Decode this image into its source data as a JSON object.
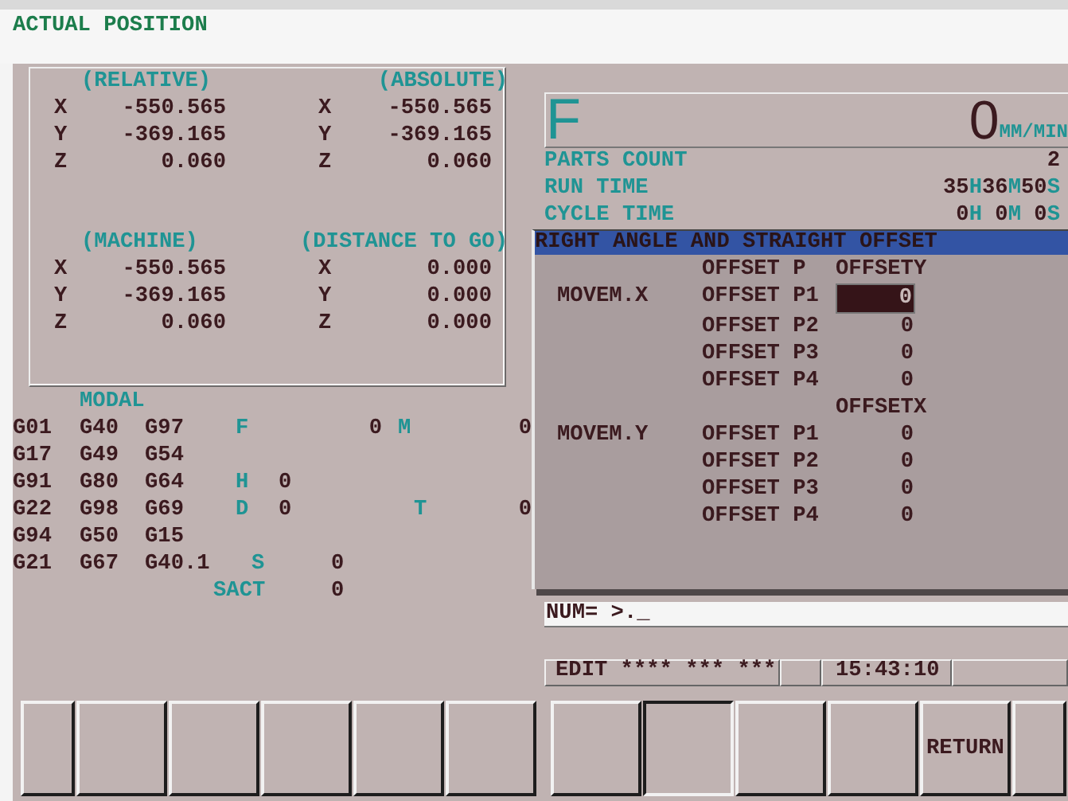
{
  "screen_title": "ACTUAL POSITION",
  "position": [
    {
      "title": "(RELATIVE)",
      "axes": [
        {
          "axis": "X",
          "value": "-550.565"
        },
        {
          "axis": "Y",
          "value": "-369.165"
        },
        {
          "axis": "Z",
          "value": "0.060"
        }
      ]
    },
    {
      "title": "(ABSOLUTE)",
      "axes": [
        {
          "axis": "X",
          "value": "-550.565"
        },
        {
          "axis": "Y",
          "value": "-369.165"
        },
        {
          "axis": "Z",
          "value": "0.060"
        }
      ]
    },
    {
      "title": "(MACHINE)",
      "axes": [
        {
          "axis": "X",
          "value": "-550.565"
        },
        {
          "axis": "Y",
          "value": "-369.165"
        },
        {
          "axis": "Z",
          "value": "0.060"
        }
      ]
    },
    {
      "title": "(DISTANCE TO GO)",
      "axes": [
        {
          "axis": "X",
          "value": "0.000"
        },
        {
          "axis": "Y",
          "value": "0.000"
        },
        {
          "axis": "Z",
          "value": "0.000"
        }
      ]
    }
  ],
  "modal": {
    "title": "MODAL",
    "g_codes": [
      [
        "G01",
        "G40",
        "G97"
      ],
      [
        "G17",
        "G49",
        "G54"
      ],
      [
        "G91",
        "G80",
        "G64"
      ],
      [
        "G22",
        "G98",
        "G69"
      ],
      [
        "G94",
        "G50",
        "G15"
      ],
      [
        "G21",
        "G67",
        "G40.1"
      ]
    ],
    "f": {
      "label": "F",
      "value": "0"
    },
    "m": {
      "label": "M",
      "value": "0"
    },
    "h": {
      "label": "H",
      "value": "0"
    },
    "d": {
      "label": "D",
      "value": "0"
    },
    "t": {
      "label": "T",
      "value": "0"
    },
    "s": {
      "label": "S",
      "value": "0"
    },
    "sact": {
      "label": "SACT",
      "value": "0"
    }
  },
  "feed": {
    "label": "F",
    "value": "0",
    "unit": "MM/MIN"
  },
  "info": [
    {
      "label": "PARTS COUNT",
      "value": [
        {
          "text": "2",
          "kind": "number"
        }
      ]
    },
    {
      "label": "RUN TIME",
      "value": [
        {
          "text": "35",
          "kind": "number"
        },
        {
          "text": "H",
          "kind": "unit"
        },
        {
          "text": "36",
          "kind": "number"
        },
        {
          "text": "M",
          "kind": "unit"
        },
        {
          "text": "50",
          "kind": "number"
        },
        {
          "text": "S",
          "kind": "unit"
        }
      ]
    },
    {
      "label": "CYCLE TIME",
      "value": [
        {
          "text": "0",
          "kind": "number"
        },
        {
          "text": "H",
          "kind": "unit"
        },
        {
          "text": " 0",
          "kind": "number"
        },
        {
          "text": "M",
          "kind": "unit"
        },
        {
          "text": " 0",
          "kind": "number"
        },
        {
          "text": "S",
          "kind": "unit"
        }
      ]
    }
  ],
  "dialog": {
    "title": "RIGHT ANGLE AND STRAIGHT OFFSET",
    "sections": [
      {
        "column_label": "OFFSET P",
        "column_header": "OFFSETY",
        "axis": "MOVEM.X",
        "rows": [
          {
            "label": "OFFSET P1",
            "value": "0",
            "selected": true
          },
          {
            "label": "OFFSET P2",
            "value": "0",
            "selected": false
          },
          {
            "label": "OFFSET P3",
            "value": "0",
            "selected": false
          },
          {
            "label": "OFFSET P4",
            "value": "0",
            "selected": false
          }
        ]
      },
      {
        "column_header": "OFFSETX",
        "axis": "MOVEM.Y",
        "rows": [
          {
            "label": "OFFSET P1",
            "value": "0",
            "selected": false
          },
          {
            "label": "OFFSET P2",
            "value": "0",
            "selected": false
          },
          {
            "label": "OFFSET P3",
            "value": "0",
            "selected": false
          },
          {
            "label": "OFFSET P4",
            "value": "0",
            "selected": false
          }
        ]
      }
    ]
  },
  "input_line": "NUM= >._",
  "status_bar": {
    "mode": "EDIT **** *** ***",
    "time": "15:43:10"
  },
  "softkeys": [
    {
      "kind": "edge",
      "selected": false
    },
    {
      "kind": "key",
      "selected": false
    },
    {
      "kind": "key",
      "selected": false
    },
    {
      "kind": "key",
      "selected": false
    },
    {
      "kind": "key",
      "selected": false
    },
    {
      "kind": "key",
      "selected": false
    },
    {
      "kind": "key",
      "selected": false
    },
    {
      "kind": "key",
      "selected": true
    },
    {
      "kind": "key",
      "selected": false
    },
    {
      "kind": "key",
      "selected": false
    },
    {
      "kind": "key",
      "label": "RETURN",
      "selected": false
    },
    {
      "kind": "edge",
      "selected": false
    }
  ]
}
